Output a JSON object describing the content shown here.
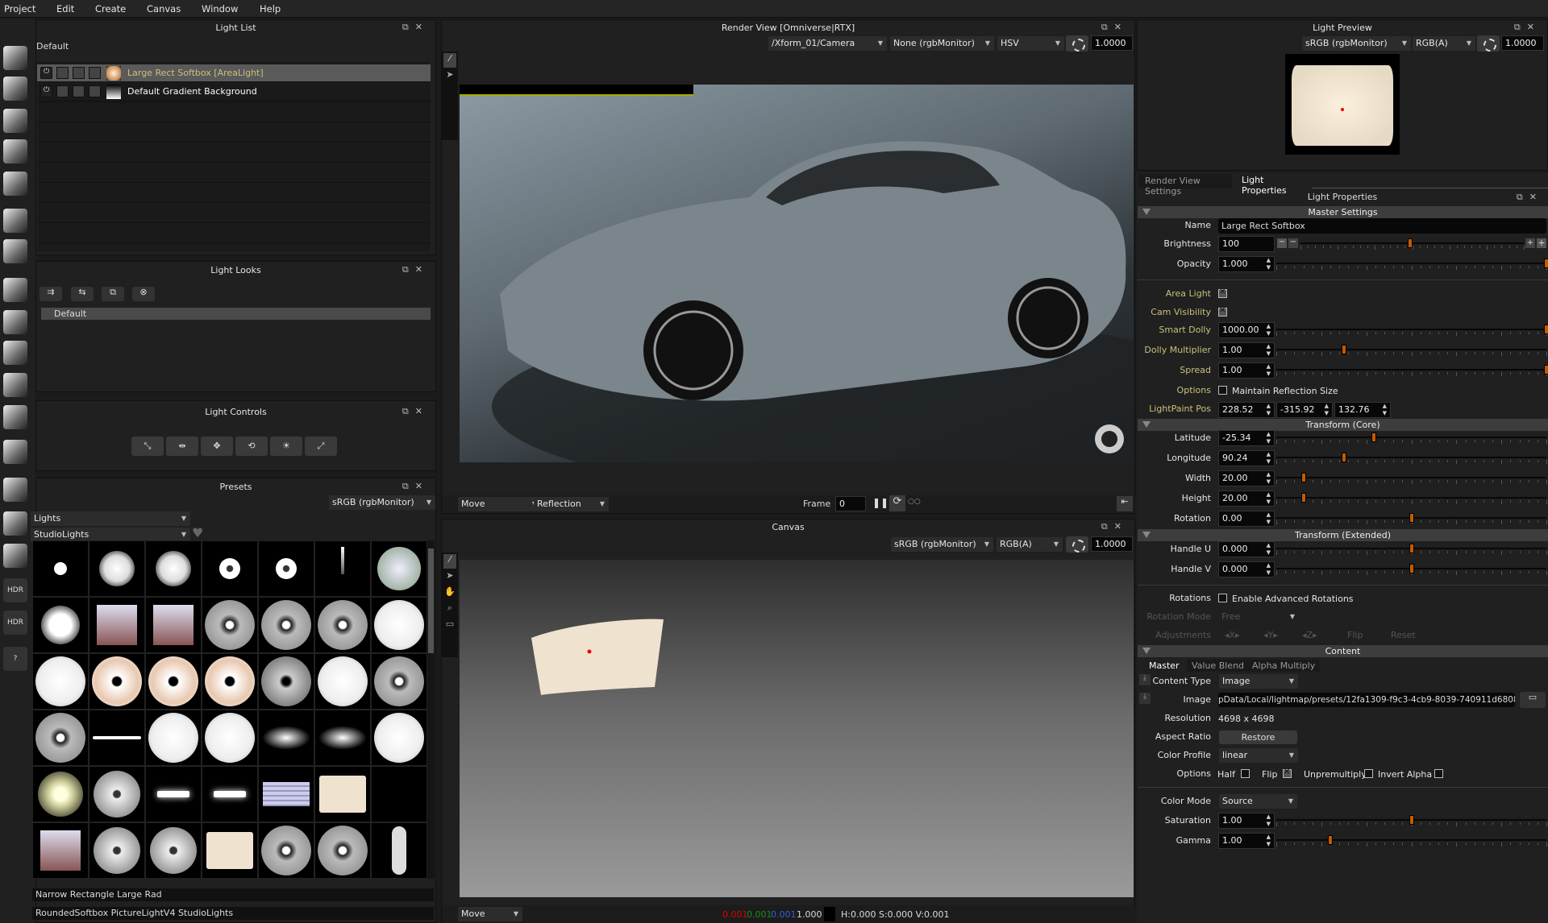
{
  "menu": [
    "Project",
    "Edit",
    "Create",
    "Canvas",
    "Window",
    "Help"
  ],
  "light_list": {
    "title": "Light List",
    "group": "Default",
    "items": [
      {
        "name": "Large Rect Softbox [AreaLight]",
        "selected": true
      },
      {
        "name": "Default Gradient Background",
        "selected": false
      }
    ]
  },
  "light_looks": {
    "title": "Light Looks",
    "items": [
      "Default"
    ]
  },
  "light_controls": {
    "title": "Light Controls"
  },
  "presets": {
    "title": "Presets",
    "color_space": "sRGB (rgbMonitor)",
    "category": "Lights",
    "library": "StudioLights",
    "footer_name": "Narrow Rectangle Large Rad",
    "footer_path": "RoundedSoftbox PictureLightV4 StudioLights"
  },
  "render_view": {
    "title": "Render View [Omniverse|RTX]",
    "camera": "/Xform_01/Camera",
    "display": "None (rgbMonitor)",
    "mode": "HSV",
    "exposure": "1.0000",
    "tool": "Move",
    "paint_mode": "Reflection",
    "frame_label": "Frame",
    "frame": "0"
  },
  "canvas": {
    "title": "Canvas",
    "color_space": "sRGB (rgbMonitor)",
    "channels": "RGB(A)",
    "exposure": "1.0000",
    "tool": "Move",
    "pixel_r": "0.001",
    "pixel_g": "0.001",
    "pixel_b": "0.001",
    "pixel_a": "1.000",
    "hsv": "H:0.000 S:0.000 V:0.001"
  },
  "light_preview": {
    "title": "Light Preview",
    "color_space": "sRGB (rgbMonitor)",
    "channels": "RGB(A)",
    "exposure": "1.0000"
  },
  "props": {
    "tabs": [
      "Render View Settings",
      "Light Properties"
    ],
    "active_tab": 1,
    "title": "Light Properties",
    "sections": {
      "master": "Master Settings",
      "core": "Transform (Core)",
      "extended": "Transform (Extended)",
      "content": "Content"
    },
    "name_label": "Name",
    "name": "Large Rect Softbox",
    "brightness_label": "Brightness",
    "brightness": "100",
    "brightness_level": 0.49,
    "rows_a": [
      {
        "label": "Opacity",
        "value": "1.000",
        "level": 1.0
      }
    ],
    "area_light_label": "Area Light",
    "area_light": true,
    "cam_visibility_label": "Cam Visibility",
    "cam_visibility": true,
    "rows_b": [
      {
        "label": "Smart Dolly",
        "value": "1000.00",
        "level": 1.0
      },
      {
        "label": "Dolly Multiplier",
        "value": "1.00",
        "level": 0.25
      },
      {
        "label": "Spread",
        "value": "1.00",
        "level": 1.0
      }
    ],
    "options_label": "Options",
    "maintain_reflection_label": "Maintain Reflection Size",
    "maintain_reflection": false,
    "lightpaint_label": "LightPaint Pos",
    "lightpaint": [
      "228.52",
      "-315.92",
      "132.76"
    ],
    "rows_core": [
      {
        "label": "Latitude",
        "value": "-25.34",
        "level": 0.36
      },
      {
        "label": "Longitude",
        "value": "90.24",
        "level": 0.25
      },
      {
        "label": "Width",
        "value": "20.00",
        "level": 0.1
      },
      {
        "label": "Height",
        "value": "20.00",
        "level": 0.1
      },
      {
        "label": "Rotation",
        "value": "0.00",
        "level": 0.5
      }
    ],
    "rows_ext": [
      {
        "label": "Handle U",
        "value": "0.000",
        "level": 0.5
      },
      {
        "label": "Handle V",
        "value": "0.000",
        "level": 0.5
      }
    ],
    "rotations_label": "Rotations",
    "adv_rot_label": "Enable Advanced Rotations",
    "adv_rot": false,
    "rotation_mode_label": "Rotation Mode",
    "rotation_mode": "Free",
    "adjustments_label": "Adjustments",
    "adj_x": "X",
    "adj_y": "Y",
    "adj_z": "Z",
    "flip_btn": "Flip",
    "reset_btn": "Reset",
    "content_tabs": [
      "Master",
      "Value Blend",
      "Alpha Multiply"
    ],
    "content_type_label": "Content Type",
    "content_type": "Image",
    "image_label": "Image",
    "image_path": "pData/Local/lightmap/presets/12fa1309-f9c3-4cb9-8039-740911d68086.tx",
    "resolution_label": "Resolution",
    "resolution": "4698 x 4698",
    "aspect_label": "Aspect Ratio",
    "restore_btn": "Restore",
    "color_profile_label": "Color Profile",
    "color_profile": "linear",
    "opt2_label": "Options",
    "half_label": "Half",
    "half": false,
    "flip_label": "Flip",
    "flip": true,
    "unpremult_label": "Unpremultiply",
    "unpremult": false,
    "invert_label": "Invert Alpha",
    "invert": false,
    "color_mode_label": "Color Mode",
    "color_mode": "Source",
    "rows_color": [
      {
        "label": "Saturation",
        "value": "1.00",
        "level": 0.5
      },
      {
        "label": "Gamma",
        "value": "1.00",
        "level": 0.2
      }
    ]
  },
  "colors": {
    "accent": "#c45a00",
    "highlight_label": "#c8c17a",
    "selected_item": "#c8c17a"
  }
}
